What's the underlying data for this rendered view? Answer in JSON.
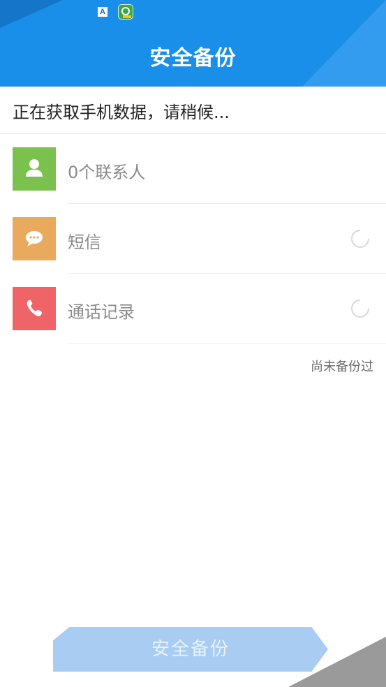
{
  "header": {
    "title": "安全备份",
    "status_icons": [
      "a-notification-icon",
      "app-store-icon"
    ]
  },
  "progress": {
    "text": "正在获取手机数据，请稍候..."
  },
  "items": [
    {
      "label": "0个联系人",
      "icon": "contact-person-icon",
      "color": "#7ac14e",
      "loading": false
    },
    {
      "label": "短信",
      "icon": "sms-bubble-icon",
      "color": "#eaaa5e",
      "loading": true
    },
    {
      "label": "通话记录",
      "icon": "phone-handset-icon",
      "color": "#ee6467",
      "loading": true
    }
  ],
  "backup_status": "尚未备份过",
  "button": {
    "label": "安全备份",
    "enabled": false
  },
  "colors": {
    "header": "#1a8fea",
    "button_disabled": "#a8ccf2"
  }
}
